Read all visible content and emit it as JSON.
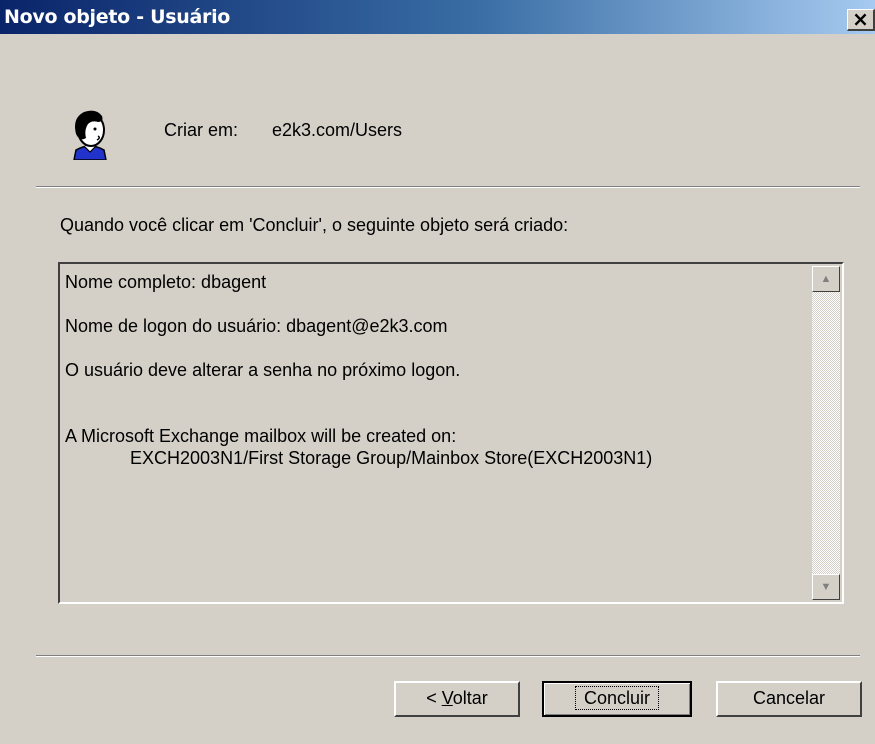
{
  "window": {
    "title": "Novo objeto - Usuário",
    "close_label": "×"
  },
  "header": {
    "create_label": "Criar em:",
    "create_path": "e2k3.com/Users",
    "avatar_icon": "user-icon"
  },
  "intro_text": "Quando você clicar em 'Concluir', o seguinte objeto será criado:",
  "summary": {
    "lines": [
      "Nome completo: dbagent",
      "",
      "Nome de logon do usuário: dbagent@e2k3.com",
      "",
      "O usuário deve alterar a senha no próximo logon.",
      "",
      "",
      "A Microsoft Exchange mailbox will be created on:",
      "             EXCH2003N1/First Storage Group/Mainbox Store(EXCH2003N1)"
    ]
  },
  "buttons": {
    "back_prefix": "< ",
    "back_accel": "V",
    "back_rest": "oltar",
    "finish": "Concluir",
    "cancel": "Cancelar"
  },
  "colors": {
    "face": "#d4d0c8",
    "title_start": "#0a246a",
    "title_end": "#a6caf0"
  }
}
